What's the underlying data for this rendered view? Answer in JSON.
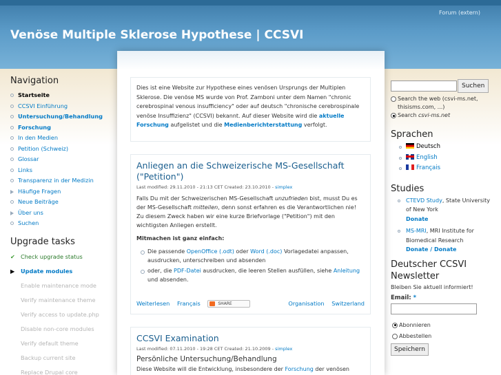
{
  "header": {
    "title": "Venöse Multiple Sklerose Hypothese | CCSVI",
    "forum_link": "Forum (extern)"
  },
  "navigation": {
    "title": "Navigation",
    "items": [
      {
        "label": "Startseite",
        "style": "active"
      },
      {
        "label": "CCSVI Einführung",
        "style": "normal"
      },
      {
        "label": "Untersuchung/Behandlung",
        "style": "bold"
      },
      {
        "label": "Forschung",
        "style": "bold"
      },
      {
        "label": "In den Medien",
        "style": "normal"
      },
      {
        "label": "Petition (Schweiz)",
        "style": "normal"
      },
      {
        "label": "Glossar",
        "style": "normal"
      },
      {
        "label": "Links",
        "style": "normal"
      },
      {
        "label": "Transparenz in der Medizin",
        "style": "normal"
      },
      {
        "label": "Häufige Fragen",
        "style": "collapsed"
      },
      {
        "label": "Neue Beiträge",
        "style": "normal"
      },
      {
        "label": "Über uns",
        "style": "collapsed"
      },
      {
        "label": "Suchen",
        "style": "normal"
      }
    ]
  },
  "upgrade": {
    "title": "Upgrade tasks",
    "tasks": [
      {
        "label": "Check upgrade status",
        "state": "done"
      },
      {
        "label": "Update modules",
        "state": "current"
      },
      {
        "label": "Enable maintenance mode",
        "state": "todo"
      },
      {
        "label": "Verify maintenance theme",
        "state": "todo"
      },
      {
        "label": "Verify access to update.php",
        "state": "todo"
      },
      {
        "label": "Disable non-core modules",
        "state": "todo"
      },
      {
        "label": "Verify default theme",
        "state": "todo"
      },
      {
        "label": "Backup current site",
        "state": "todo"
      },
      {
        "label": "Replace Drupal core",
        "state": "todo"
      }
    ]
  },
  "intro": {
    "text1": "Dies ist eine Website zur Hypothese eines venösen Ursprungs der Multiplen Sklerose. Die venöse MS wurde von Prof. Zamboni unter dem Namen \"chronic cerebrospinal venous insufficiency\" oder auf deutsch \"chronische cerebrospinale venöse Insuffizienz\" (CCSVI) bekannt. Auf dieser Website wird die ",
    "link1": "aktuelle Forschung",
    "text2": " aufgelistet und die ",
    "link2": "Medienberichterstattung",
    "text3": " verfolgt."
  },
  "node1": {
    "title": "Anliegen an die Schweizerische MS-Gesellschaft (\"Petition\")",
    "meta_prefix": "Last modified: 29.11.2010 - 21:13 CET Created: 23.10.2010 - ",
    "author": "simplex",
    "p1a": "Falls Du mit der Schweizerischen MS-Gesellschaft ",
    "p1b": "unzufrieden",
    "p1c": " bist, musst Du es der MS-Gesellschaft ",
    "p1d": "mitteilen",
    "p1e": ", denn sonst erfahren es die Verantwortlichen nie! Zu diesem Zweck haben wir eine kurze Briefvorlage (\"Petition\") mit den wichtigsten Anliegen erstellt.",
    "p2": "Mitmachen ist ganz einfach:",
    "li1a": "Die passende ",
    "li1b": "OpenOffice (.odt)",
    "li1c": " oder ",
    "li1d": "Word (.doc)",
    "li1e": " Vorlagedatei anpassen, ausdrucken, unterschreiben und absenden",
    "li2a": "oder, die ",
    "li2b": "PDF-Datei",
    "li2c": " ausdrucken, die leeren Stellen ausfüllen, siehe ",
    "li2d": "Anleitung",
    "li2e": " und absenden.",
    "read_more": "Weiterlesen",
    "lang": "Français",
    "share": "SHARE",
    "tag1": "Organisation",
    "tag2": "Switzerland"
  },
  "node2": {
    "title": "CCSVI Examination",
    "meta_prefix": "Last modified: 07.11.2010 - 19:28 CET Created: 21.10.2009 - ",
    "author": "simplex",
    "subheading": "Persönliche Untersuchung/Behandlung",
    "text_a": "Diese Website will die Entwicklung, insbesondere der ",
    "text_link": "Forschung",
    "text_b": " der venösen"
  },
  "search": {
    "button": "Suchen",
    "option1": "Search the web (csvi-ms.net, thisisms.com, ...)",
    "option2_prefix": "Search ",
    "option2_site": "csvi-ms.net"
  },
  "languages": {
    "title": "Sprachen",
    "items": [
      "Deutsch",
      "English",
      "Français"
    ]
  },
  "studies": {
    "title": "Studies",
    "s1_link": "CTEVD Study",
    "s1_text": ", State University of New York",
    "s1_donate": "Donate",
    "s2_link": "MS-MRI",
    "s2_text": ", MRI Institute for Biomedical Research",
    "s2_donate1": "Donate",
    "s2_sep": " / ",
    "s2_donate2": "Donate"
  },
  "newsletter": {
    "title": "Deutscher CCSVI Newsletter",
    "subtitle": "Bleiben Sie aktuell informiert!",
    "email_label": "Email:",
    "required": "*",
    "opt_subscribe": "Abonnieren",
    "opt_unsubscribe": "Abbestellen",
    "save": "Speichern"
  }
}
